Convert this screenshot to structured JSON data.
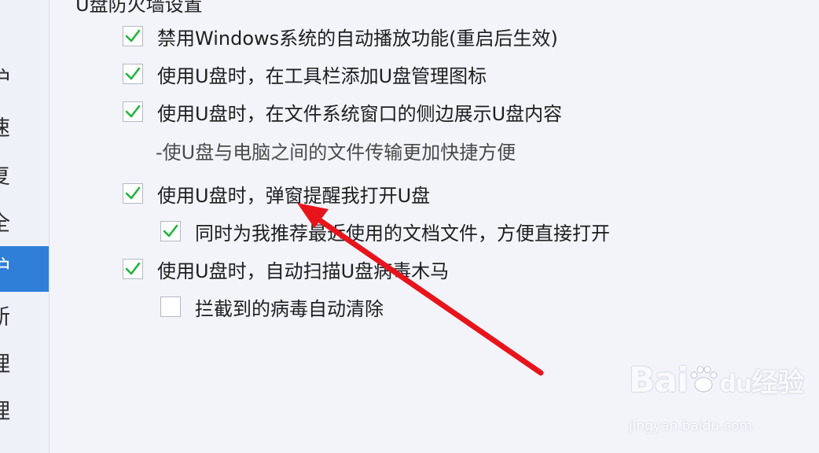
{
  "section_title": "U盘防火墙设置",
  "sidebar": {
    "items": [
      {
        "label": "护",
        "active": false
      },
      {
        "label": "速",
        "active": false
      },
      {
        "label": "复",
        "active": false
      },
      {
        "label": "全",
        "active": false
      },
      {
        "label": "护",
        "active": true
      },
      {
        "label": "新",
        "active": false
      },
      {
        "label": "理",
        "active": false
      },
      {
        "label": "理",
        "active": false
      }
    ]
  },
  "options": [
    {
      "label": "禁用Windows系统的自动播放功能(重启后生效)",
      "checked": true
    },
    {
      "label": "使用U盘时，在工具栏添加U盘管理图标",
      "checked": true
    },
    {
      "label": "使用U盘时，在文件系统窗口的侧边展示U盘内容",
      "checked": true
    },
    {
      "note": "-使U盘与电脑之间的文件传输更加快捷方便"
    },
    {
      "label": "使用U盘时，弹窗提醒我打开U盘",
      "checked": true
    },
    {
      "label": "同时为我推荐最近使用的文档文件，方便直接打开",
      "checked": true
    },
    {
      "label": "使用U盘时，自动扫描U盘病毒木马",
      "checked": true
    },
    {
      "label": "拦截到的病毒自动清除",
      "checked": false
    }
  ],
  "annotation_arrow_color": "#e8141c",
  "check_color": "#1fb53b",
  "watermark": {
    "brand": "Bai",
    "paw": "du",
    "cn": "经验",
    "url": "jingyan.baidu.com"
  }
}
